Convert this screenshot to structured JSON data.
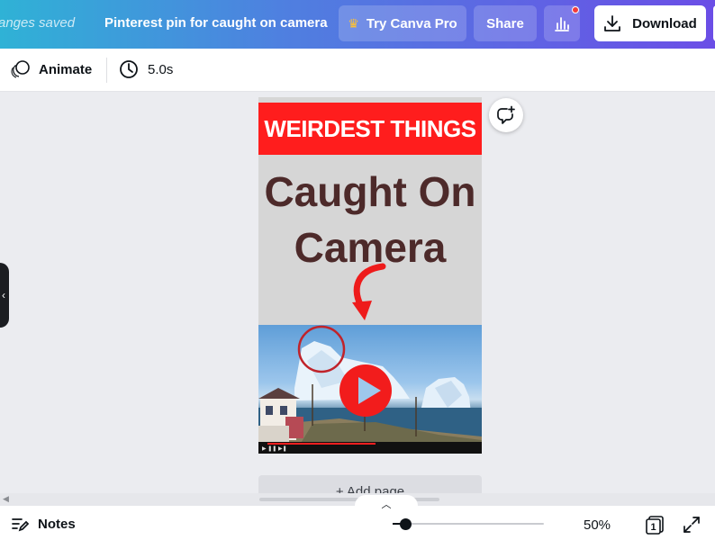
{
  "header": {
    "save_status": "anges saved",
    "doc_title": "Pinterest pin for caught on camera",
    "try_pro_label": "Try Canva Pro",
    "share_label": "Share",
    "download_label": "Download"
  },
  "toolbar": {
    "animate_label": "Animate",
    "duration_label": "5.0s"
  },
  "design": {
    "banner_text": "WEIRDEST THINGS",
    "headline_line1": "Caught On",
    "headline_line2": "Camera",
    "add_page_label": "+ Add page"
  },
  "footer": {
    "notes_label": "Notes",
    "zoom_percent": "50%",
    "zoom_level": 0.5,
    "page_count": "1"
  },
  "colors": {
    "banner_red": "#ff1d1d",
    "headline_brown": "#4d2a2a",
    "header_gradient_start": "#2fb2d6",
    "header_gradient_end": "#6b4ee6"
  }
}
